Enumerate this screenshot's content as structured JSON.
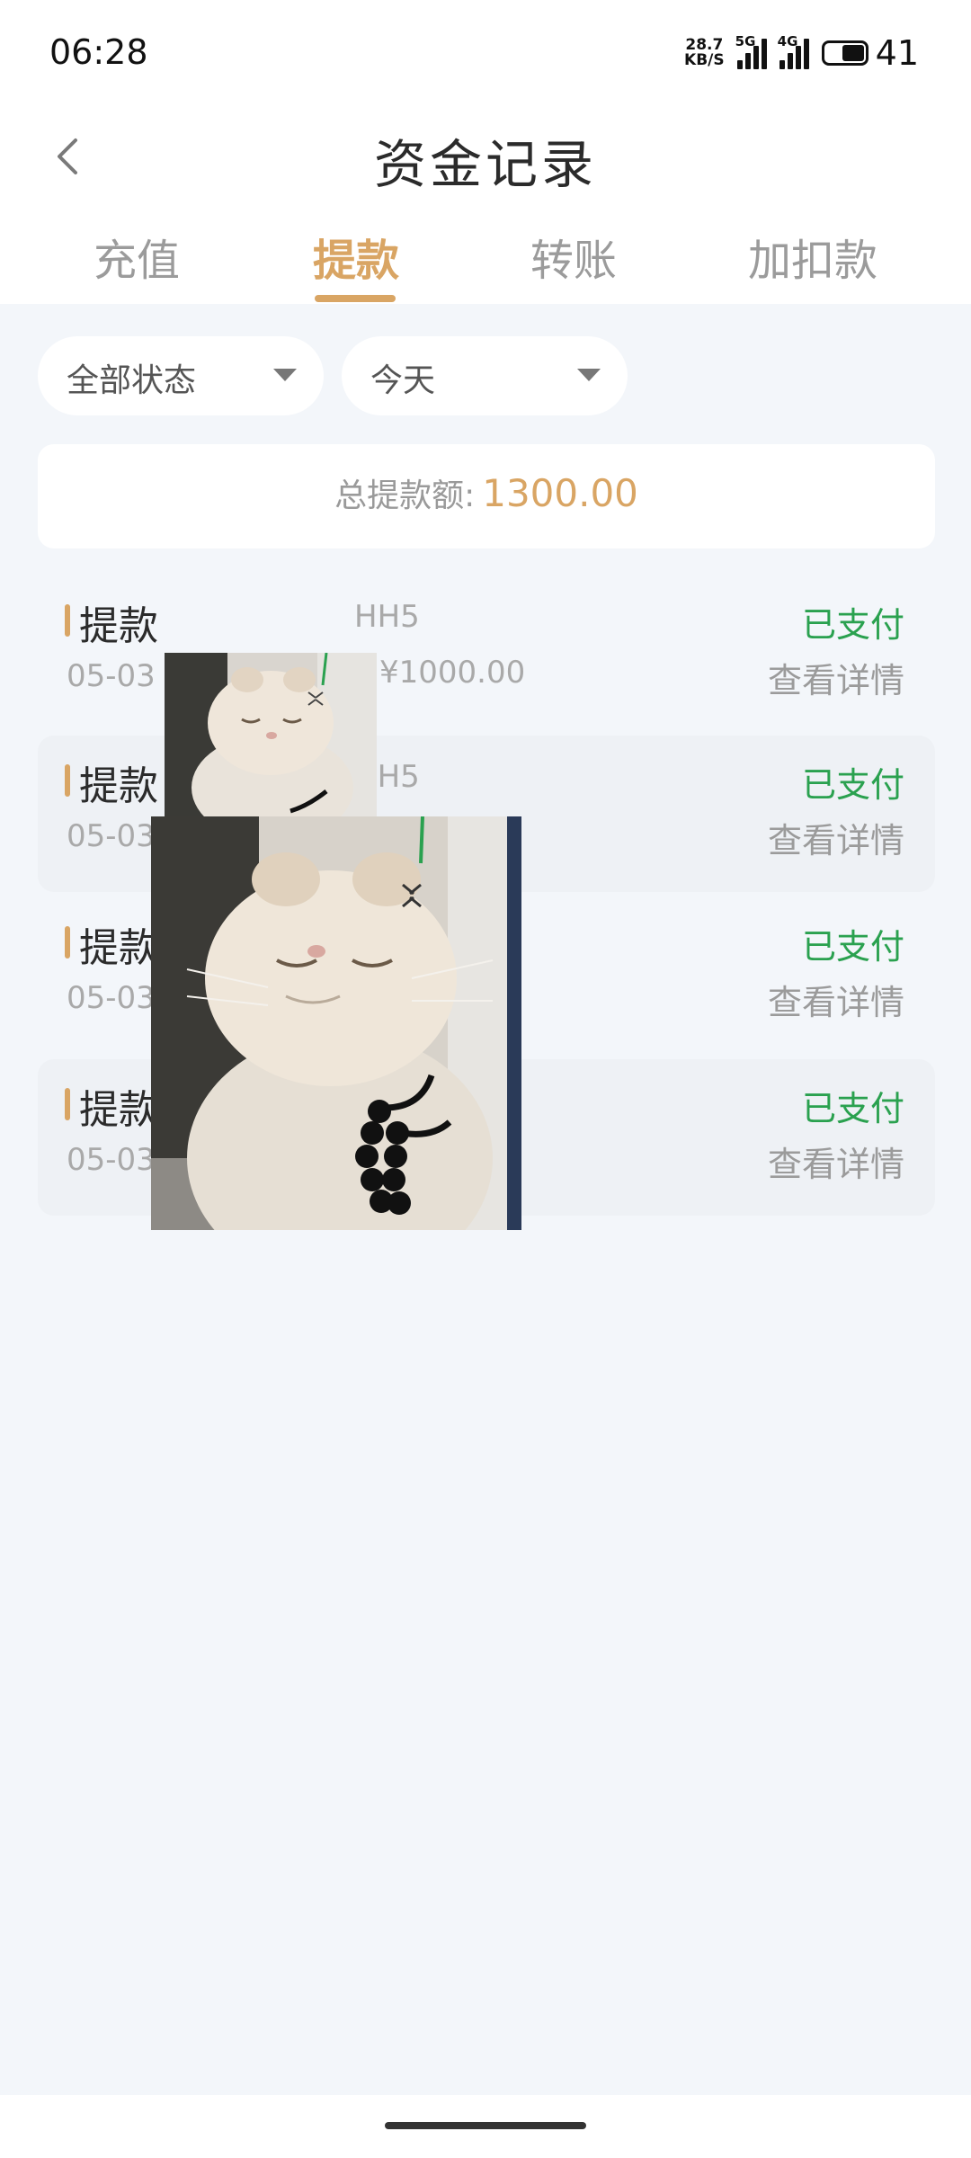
{
  "status_bar": {
    "time": "06:28",
    "net_speed_value": "28.7",
    "net_speed_unit": "KB/S",
    "signal1_tag": "5G",
    "signal2_tag": "4G",
    "battery": "41"
  },
  "header": {
    "title": "资金记录"
  },
  "tabs": [
    {
      "label": "充值",
      "active": false
    },
    {
      "label": "提款",
      "active": true
    },
    {
      "label": "转账",
      "active": false
    },
    {
      "label": "加扣款",
      "active": false
    }
  ],
  "filters": {
    "status": "全部状态",
    "date": "今天"
  },
  "summary": {
    "label": "总提款额:",
    "value": "1300.00"
  },
  "records": [
    {
      "type": "提款",
      "date": "05-03",
      "channel": "HH5",
      "amount": "¥1000.00",
      "status": "已支付",
      "detail": "查看详情"
    },
    {
      "type": "提款",
      "date": "05-03",
      "channel": "HH5",
      "amount": "",
      "status": "已支付",
      "detail": "查看详情"
    },
    {
      "type": "提款",
      "date": "05-03",
      "channel": "",
      "amount": "",
      "status": "已支付",
      "detail": "查看详情"
    },
    {
      "type": "提款",
      "date": "05-03",
      "channel": "",
      "amount": "",
      "status": "已支付",
      "detail": "查看详情"
    }
  ],
  "colors": {
    "accent": "#d9a564",
    "status_paid": "#2aa14f",
    "background": "#f3f6fa"
  },
  "icons": {
    "back": "chevron-left-icon",
    "dropdown": "caret-down-icon"
  }
}
